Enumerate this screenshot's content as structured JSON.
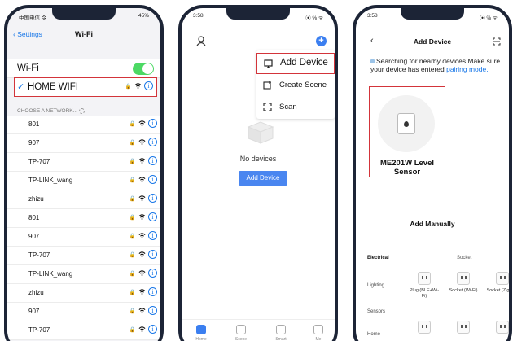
{
  "colors": {
    "accent": "#1a78e8",
    "highlight": "#d3343a",
    "toggle_on": "#4cd964",
    "button": "#4a86f0"
  },
  "phone1": {
    "status_left": "中国电信 令",
    "status_right": "45%",
    "back_label": "Settings",
    "title": "Wi-Fi",
    "wifi_label": "Wi-Fi",
    "wifi_on": true,
    "connected_network": "HOME WIFI",
    "choose_label": "CHOOSE A NETWORK...",
    "networks": [
      {
        "name": "801"
      },
      {
        "name": "907"
      },
      {
        "name": "TP-707"
      },
      {
        "name": "TP-LINK_wang"
      },
      {
        "name": "zhizu"
      },
      {
        "name": "801"
      },
      {
        "name": "907"
      },
      {
        "name": "TP-707"
      },
      {
        "name": "TP-LINK_wang"
      },
      {
        "name": "zhizu"
      },
      {
        "name": "907"
      },
      {
        "name": "TP-707"
      }
    ]
  },
  "phone2": {
    "status_time": "3:58",
    "status_right": "⦿ ℅ ᯤ",
    "menu": {
      "add_device": "Add Device",
      "create_scene": "Create Scene",
      "scan": "Scan"
    },
    "empty_text": "No devices",
    "add_button": "Add Device",
    "tabs": [
      "Home",
      "Scene",
      "Smart",
      "Me"
    ]
  },
  "phone3": {
    "status_time": "3:58",
    "status_right": "⦿ ℅ ᯤ",
    "title": "Add Device",
    "searching_text": "Searching for nearby devices.Make sure your device has entered ",
    "searching_link": "pairing mode.",
    "device_name": "ME201W Level Sensor",
    "add_manually": "Add Manually",
    "categories": [
      "Electrical",
      "Lighting",
      "Sensors",
      "Home"
    ],
    "column_header": "Socket",
    "products": [
      {
        "label": "Plug (BLE+Wi-Fi)"
      },
      {
        "label": "Socket (Wi-Fi)"
      },
      {
        "label": "Socket (Zigbee)"
      }
    ]
  }
}
